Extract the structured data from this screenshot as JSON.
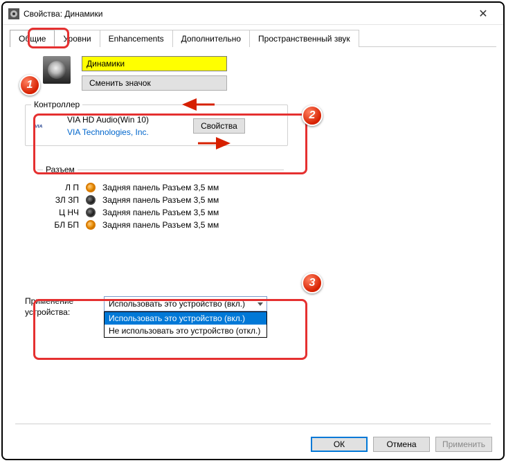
{
  "window": {
    "title": "Свойства: Динамики"
  },
  "tabs": {
    "general": "Общие",
    "levels": "Уровни",
    "enhancements": "Enhancements",
    "advanced": "Дополнительно",
    "spatial": "Пространственный звук"
  },
  "device": {
    "name_value": "Динамики",
    "change_icon": "Сменить значок"
  },
  "controller": {
    "group_title": "Контроллер",
    "name": "VIA HD Audio(Win 10)",
    "vendor": "VIA Technologies, Inc.",
    "properties_btn": "Свойства"
  },
  "jacks": {
    "group_title": "Разъем",
    "rows": [
      {
        "label": "Л П",
        "desc": "Задняя панель Разъем 3,5 мм"
      },
      {
        "label": "ЗЛ ЗП",
        "desc": "Задняя панель Разъем 3,5 мм"
      },
      {
        "label": "Ц НЧ",
        "desc": "Задняя панель Разъем 3,5 мм"
      },
      {
        "label": "БЛ БП",
        "desc": "Задняя панель Разъем 3,5 мм"
      }
    ]
  },
  "usage": {
    "label": "Применение устройства:",
    "selected": "Использовать это устройство (вкл.)",
    "option_on": "Использовать это устройство (вкл.)",
    "option_off": "Не использовать это устройство (откл.)"
  },
  "buttons": {
    "ok": "ОК",
    "cancel": "Отмена",
    "apply": "Применить"
  }
}
